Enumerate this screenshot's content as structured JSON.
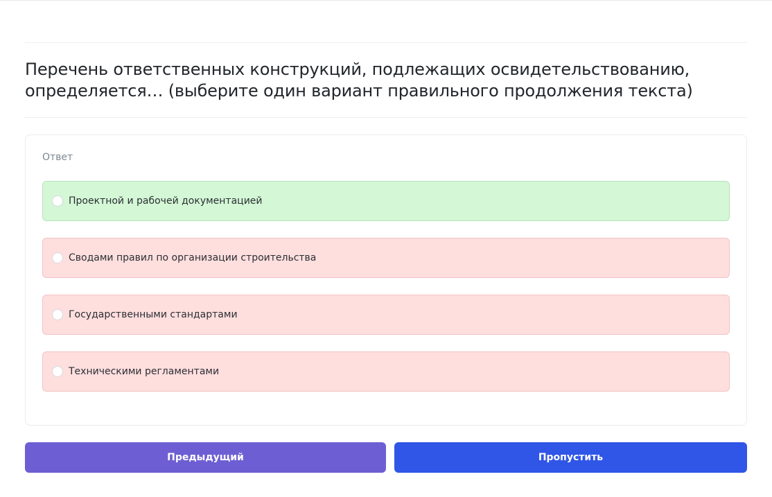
{
  "question": {
    "text": "Перечень ответственных конструкций, подлежащих освидетельствованию, определяется… (выберите один вариант правильного продолжения текста)"
  },
  "answer": {
    "label": "Ответ",
    "options": [
      {
        "label": "Проектной и рабочей документацией",
        "status": "correct",
        "selected": false
      },
      {
        "label": "Сводами правил по организации строительства",
        "status": "wrong",
        "selected": false
      },
      {
        "label": "Государственными стандартами",
        "status": "wrong",
        "selected": false
      },
      {
        "label": "Техническими регламентами",
        "status": "wrong",
        "selected": false
      }
    ]
  },
  "buttons": {
    "previous_label": "Предыдущий",
    "skip_label": "Пропустить"
  },
  "colors": {
    "correct_bg": "#d4f7d6",
    "wrong_bg": "#ffdede",
    "previous_button": "#6d5fd3",
    "skip_button": "#3056e7"
  }
}
